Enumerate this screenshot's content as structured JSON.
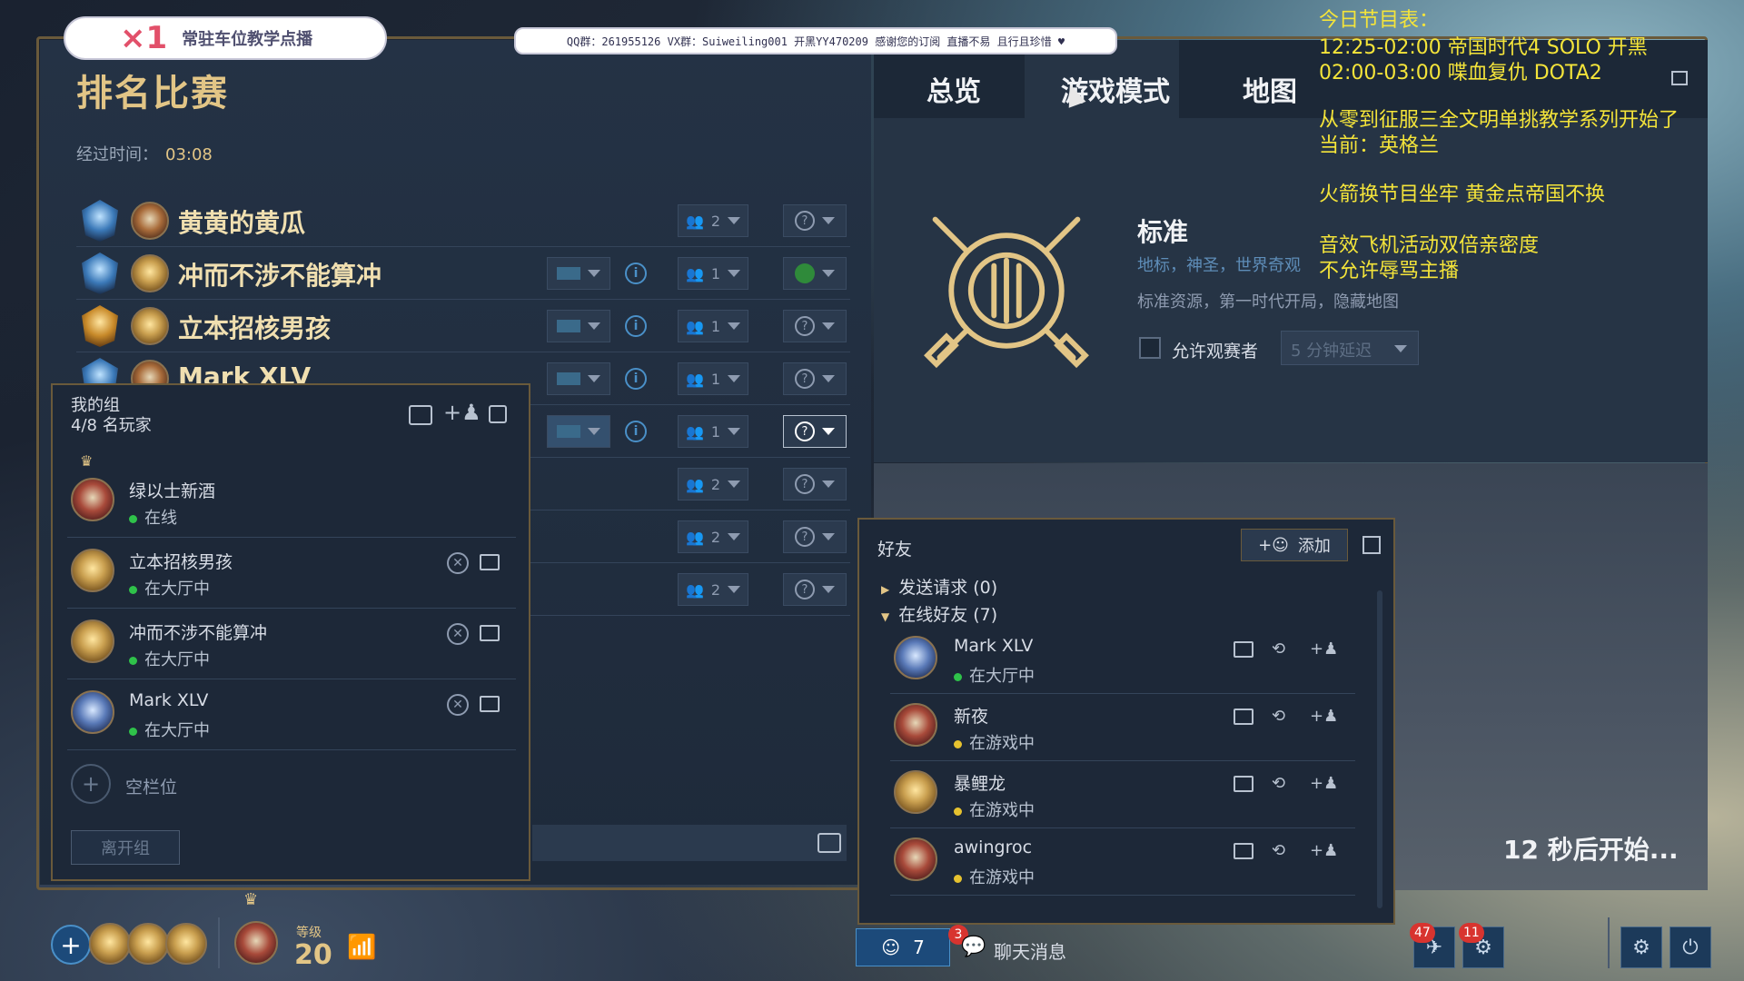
{
  "banners": {
    "left_count": "×1",
    "left_text": "常驻车位教学点播",
    "top_text": "QQ群：261955126  VX群：Suiweiling001  开黑YY470209  感谢您的订阅 直播不易 且行且珍惜 ♥"
  },
  "main": {
    "title": "排名比赛",
    "elapsed_label": "经过时间：",
    "elapsed_value": "03:08",
    "players": [
      {
        "name": "黄黄的黄瓜",
        "team": "2",
        "status": "?"
      },
      {
        "name": "冲而不涉不能算冲",
        "team": "1",
        "status": "ready"
      },
      {
        "name": "立本招核男孩",
        "team": "1",
        "status": "?"
      },
      {
        "name": "Mark XLV",
        "team": "1",
        "status": "?"
      },
      {
        "name": "",
        "team": "1",
        "status": "?"
      },
      {
        "name": "",
        "team": "2",
        "status": "?"
      },
      {
        "name": "",
        "team": "2",
        "status": "?"
      },
      {
        "name": "",
        "team": "2",
        "status": "?"
      }
    ]
  },
  "tabs": [
    {
      "label": "总览"
    },
    {
      "label": "游戏模式"
    },
    {
      "label": "地图"
    }
  ],
  "mode": {
    "title": "标准",
    "subtitle": "地标，神圣，世界奇观",
    "desc": "标准资源，第一时代开局，隐藏地图",
    "allow_spectators": "允许观赛者",
    "delay": "5 分钟延迟"
  },
  "countdown": "12 秒后开始...",
  "overlay": {
    "line1": "今日节目表：",
    "line2": "12:25-02:00 帝国时代4 SOLO 开黑",
    "line3": "02:00-03:00 喋血复仇 DOTA2",
    "line4": "从零到征服三全文明单挑教学系列开始了",
    "line5": "当前：英格兰",
    "line6": "火箭换节目坐牢  黄金点帝国不换",
    "line7": "音效飞机活动双倍亲密度",
    "line8": "不允许辱骂主播"
  },
  "group": {
    "title": "我的组",
    "count": "4/8 名玩家",
    "members": [
      {
        "name": "绿以士新酒",
        "status": "在线"
      },
      {
        "name": "立本招核男孩",
        "status": "在大厅中"
      },
      {
        "name": "冲而不涉不能算冲",
        "status": "在大厅中"
      },
      {
        "name": "Mark XLV",
        "status": "在大厅中"
      }
    ],
    "empty_slot": "空栏位",
    "leave": "离开组"
  },
  "friends": {
    "title": "好友",
    "add": "添加",
    "sent_requests": "发送请求 (0)",
    "online_friends": "在线好友 (7)",
    "list": [
      {
        "name": "Mark XLV",
        "status": "在大厅中"
      },
      {
        "name": "新夜",
        "status": "在游戏中"
      },
      {
        "name": "暴鲤龙",
        "status": "在游戏中"
      },
      {
        "name": "awingroc",
        "status": "在游戏中"
      }
    ]
  },
  "bottom": {
    "level_label": "等级",
    "level": "20",
    "friends_online": "7",
    "chat_badge": "3",
    "chat_label": "聊天消息",
    "notif1": "47",
    "notif2": "11"
  },
  "colors": {
    "gold": "#e2c586",
    "accent_blue": "#4a90c8",
    "online_green": "#2fc24a",
    "ingame_yellow": "#e6c22f",
    "overlay_yellow": "#f4e43a"
  }
}
